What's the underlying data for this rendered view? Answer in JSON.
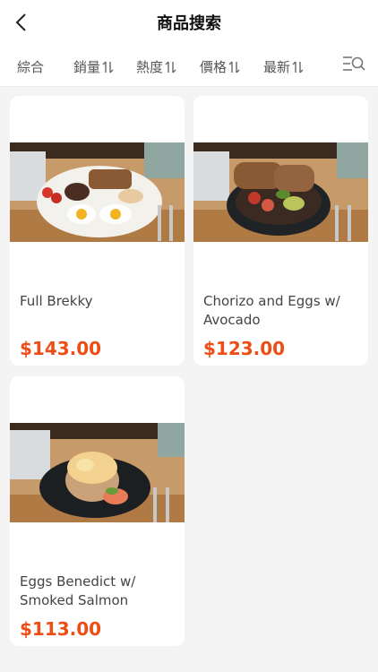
{
  "header": {
    "title": "商品搜索"
  },
  "sort_tabs": [
    {
      "label": "綜合",
      "has_arrows": false
    },
    {
      "label": "銷量",
      "has_arrows": true
    },
    {
      "label": "熱度",
      "has_arrows": true
    },
    {
      "label": "價格",
      "has_arrows": true
    },
    {
      "label": "最新",
      "has_arrows": true
    }
  ],
  "icons": {
    "back": "chevron-left-icon",
    "filter": "filter-search-icon",
    "sort": "sort-arrows-icon"
  },
  "products": [
    {
      "name": "Full Brekky",
      "price": "$143.00"
    },
    {
      "name": "Chorizo and Eggs w/ Avocado",
      "price": "$123.00"
    },
    {
      "name": "Eggs Benedict w/ Smoked Salmon",
      "price": "$113.00"
    }
  ],
  "colors": {
    "price": "#ee4e16",
    "background": "#f4f4f4"
  }
}
